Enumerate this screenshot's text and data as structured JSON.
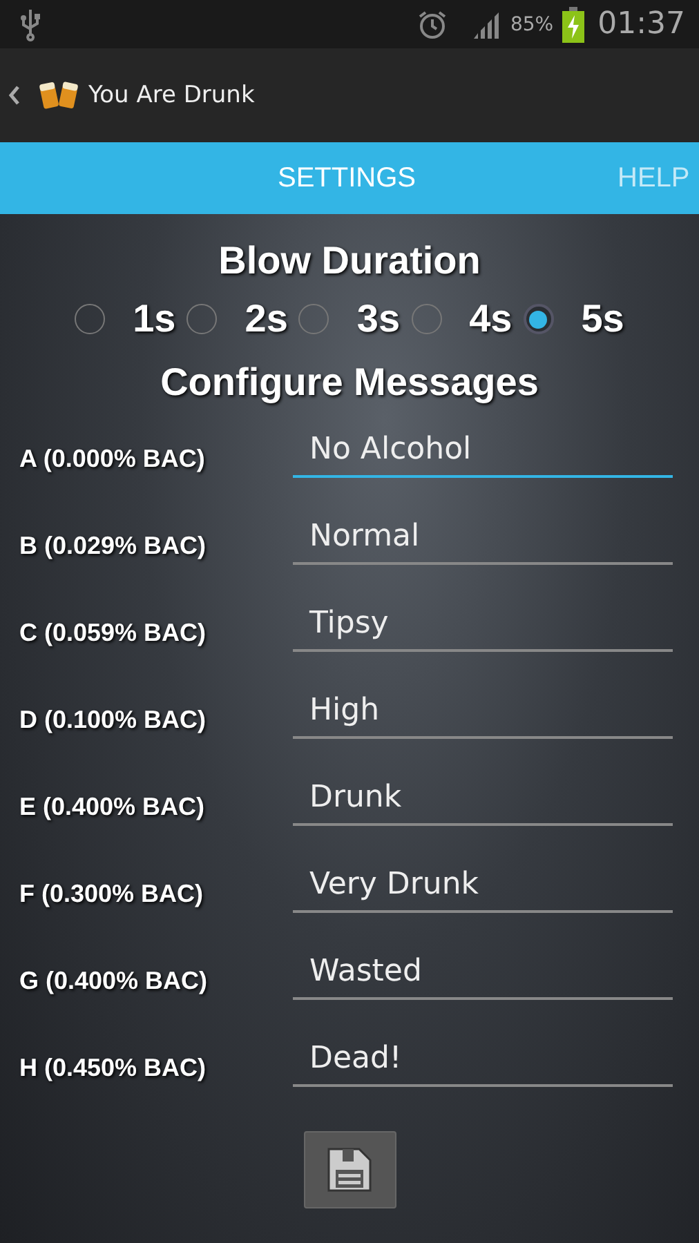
{
  "status_bar": {
    "battery": "85%",
    "time": "01:37"
  },
  "action_bar": {
    "title": "You Are Drunk"
  },
  "tabs": [
    {
      "label": "SETTINGS",
      "selected": true
    },
    {
      "label": "HELP",
      "selected": false
    }
  ],
  "blow_duration": {
    "title": "Blow Duration",
    "options": [
      {
        "label": "1s",
        "selected": false
      },
      {
        "label": "2s",
        "selected": false
      },
      {
        "label": "3s",
        "selected": false
      },
      {
        "label": "4s",
        "selected": false
      },
      {
        "label": "5s",
        "selected": true
      }
    ]
  },
  "messages": {
    "title": "Configure Messages",
    "rows": [
      {
        "label": "A (0.000% BAC)",
        "value": "No Alcohol",
        "focused": true
      },
      {
        "label": "B (0.029% BAC)",
        "value": "Normal",
        "focused": false
      },
      {
        "label": "C (0.059% BAC)",
        "value": "Tipsy",
        "focused": false
      },
      {
        "label": "D (0.100% BAC)",
        "value": "High",
        "focused": false
      },
      {
        "label": "E (0.400% BAC)",
        "value": "Drunk",
        "focused": false
      },
      {
        "label": "F (0.300% BAC)",
        "value": "Very Drunk",
        "focused": false
      },
      {
        "label": "G (0.400% BAC)",
        "value": "Wasted",
        "focused": false
      },
      {
        "label": "H (0.450% BAC)",
        "value": "Dead!",
        "focused": false
      }
    ]
  }
}
